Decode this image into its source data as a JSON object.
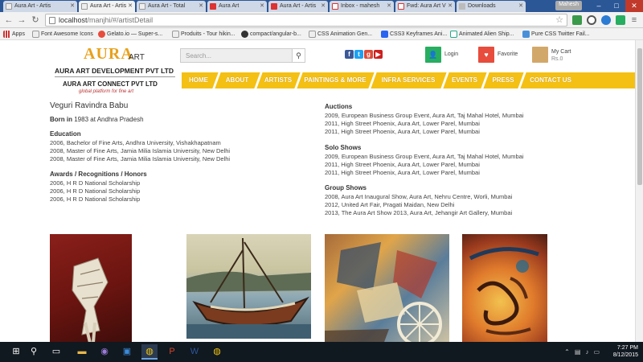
{
  "browser": {
    "tabs": [
      {
        "title": "Aura Art - Artis",
        "active": false
      },
      {
        "title": "Aura Art - Artis",
        "active": true
      },
      {
        "title": "Aura Art - Total",
        "active": false
      },
      {
        "title": "Aura Art",
        "active": false
      },
      {
        "title": "Aura Art - Artis",
        "active": false
      },
      {
        "title": "Inbox - mahesh",
        "active": false
      },
      {
        "title": "Fwd: Aura Art V",
        "active": false
      },
      {
        "title": "Downloads",
        "active": false
      }
    ],
    "user": "Mahesh",
    "url_host": "localhost",
    "url_path": "/manjhi/#/artistDetail",
    "bookmarks": [
      "Apps",
      "Font Awesome Icons",
      "Gelato.io — Super-s...",
      "Produits - Tour hikin...",
      "compact/angular-b...",
      "CSS Animation Gen...",
      "CSS3 Keyframes Ani...",
      "Animated Alien Ship...",
      "Pure CSS Twitter Fail..."
    ]
  },
  "header": {
    "logo_main": "AURA",
    "logo_art": "ART",
    "logo_company": "AURA ART DEVELOPMENT PVT LTD",
    "logo_connect": "AURA ART CONNECT PVT LTD",
    "logo_tagline": "global platform for fine art",
    "search_placeholder": "Search...",
    "login_label": "Login",
    "favorite_label": "Favorite",
    "cart_label": "My Cart",
    "cart_amount": "Rs.0"
  },
  "nav": [
    "HOME",
    "ABOUT",
    "ARTISTS",
    "PAINTINGS & MORE",
    "INFRA SERVICES",
    "EVENTS",
    "PRESS",
    "CONTACT US"
  ],
  "artist": {
    "name": "Veguri Ravindra Babu",
    "born_label": "Born in",
    "born_value": "1983 at Andhra Pradesh",
    "education_title": "Education",
    "education": [
      "2006, Bachelor of Fine Arts, Andhra University, Vishakhapatnam",
      "2008, Master of Fine Arts, Jamia Milia Islamia University, New Delhi",
      "2008, Master of Fine Arts, Jamia Milia Islamia University, New Delhi"
    ],
    "awards_title": "Awards / Recognitions / Honors",
    "awards": [
      "2006, H R D National Scholarship",
      "2006, H R D National Scholarship",
      "2006, H R D National Scholarship"
    ],
    "auctions_title": "Auctions",
    "auctions": [
      "2009, European Business Group Event, Aura Art, Taj Mahal Hotel, Mumbai",
      "2011, High Street Phoenix, Aura Art, Lower Parel, Mumbai",
      "2011, High Street Phoenix, Aura Art, Lower Parel, Mumbai"
    ],
    "solo_title": "Solo Shows",
    "solo": [
      "2009, European Business Group Event, Aura Art, Taj Mahal Hotel, Mumbai",
      "2011, High Street Phoenix, Aura Art, Lower Parel, Mumbai",
      "2011, High Street Phoenix, Aura Art, Lower Parel, Mumbai"
    ],
    "group_title": "Group Shows",
    "group": [
      "2008, Aura Art Inaugural Show, Aura Art, Nehru Centre, Worli, Mumbai",
      "2012, United Art Fair, Pragati Maidan, New Delhi",
      "2013, The Aura Art Show 2013, Aura Art, Jehangir Art Gallery, Mumbai"
    ]
  },
  "taskbar": {
    "time": "7:27 PM",
    "date": "8/12/2015"
  }
}
